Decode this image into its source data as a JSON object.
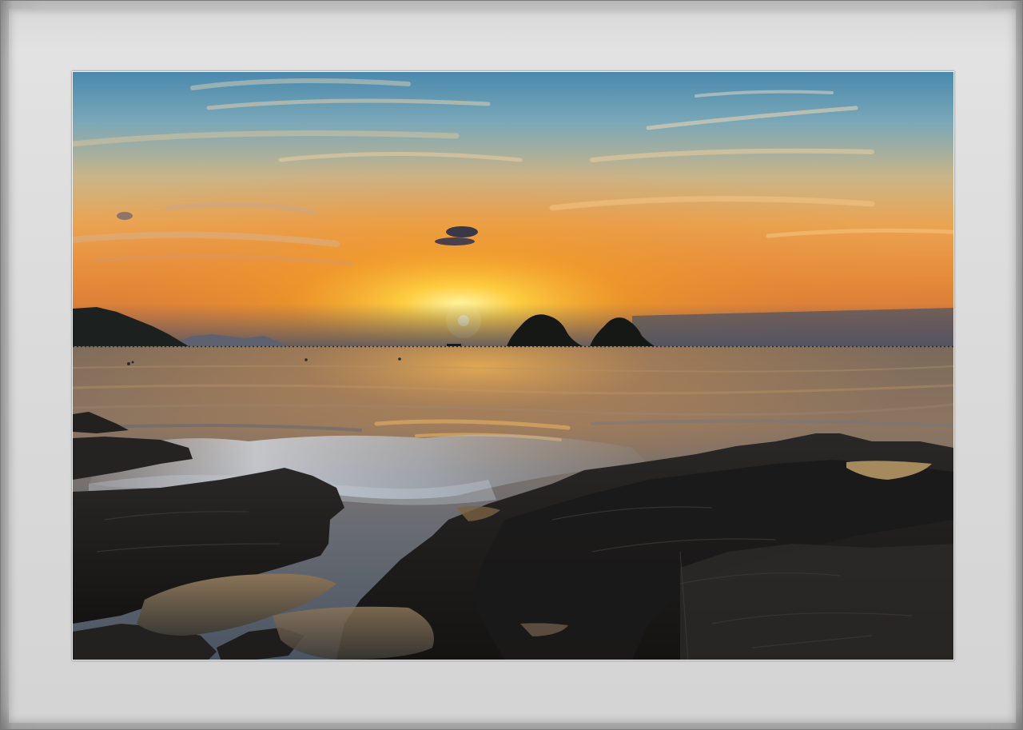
{
  "image": {
    "subject": "sunset-seascape",
    "palette": {
      "sky_top": "#4f8fb0",
      "sky_mid": "#e6a15a",
      "sky_glow": "#f5a623",
      "sun": "#fff1b0",
      "sea": "#6b6a6a",
      "rock": "#1e1d1c",
      "frame": "#d6d6d6"
    }
  }
}
